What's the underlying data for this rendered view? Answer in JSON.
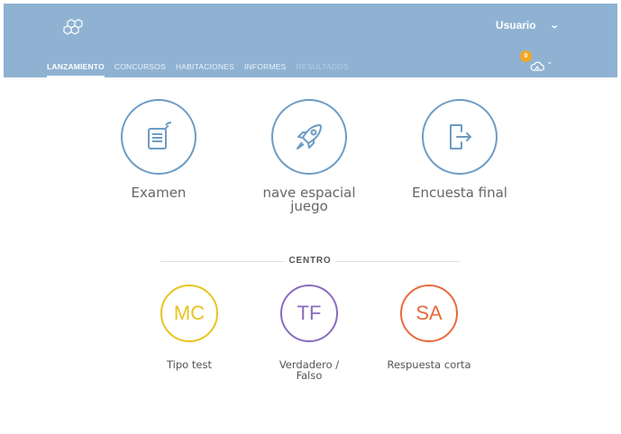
{
  "header": {
    "logo_icon": "hexagon-logo-icon",
    "user_label": "Usuario",
    "notification_count": "0",
    "cloud_icon": "cloud-icon"
  },
  "nav": {
    "tabs": [
      {
        "label": "LANZAMIENTO",
        "state": "active"
      },
      {
        "label": "CONCURSOS",
        "state": "normal"
      },
      {
        "label": "HABITACIONES",
        "state": "normal"
      },
      {
        "label": "INFORMES",
        "state": "normal"
      },
      {
        "label": "RESULTADOS",
        "state": "disabled"
      }
    ]
  },
  "launch": {
    "items": [
      {
        "label": "Examen",
        "icon": "quiz-icon"
      },
      {
        "label_line1": "nave espacial",
        "label_line2": "juego",
        "icon": "rocket-icon"
      },
      {
        "label": "Encuesta final",
        "icon": "exit-icon"
      }
    ]
  },
  "centro": {
    "title": "CENTRO",
    "items": [
      {
        "abbr": "MC",
        "label": "Tipo test",
        "color": "#e8c41f"
      },
      {
        "abbr": "TF",
        "label_line1": "Verdadero /",
        "label_line2": "Falso",
        "color": "#8a6bbf"
      },
      {
        "abbr": "SA",
        "label": "Respuesta corta",
        "color": "#e86a3c"
      }
    ]
  },
  "colors": {
    "header_bg": "#8fb2d2",
    "launch_accent": "#6d9cc4"
  }
}
